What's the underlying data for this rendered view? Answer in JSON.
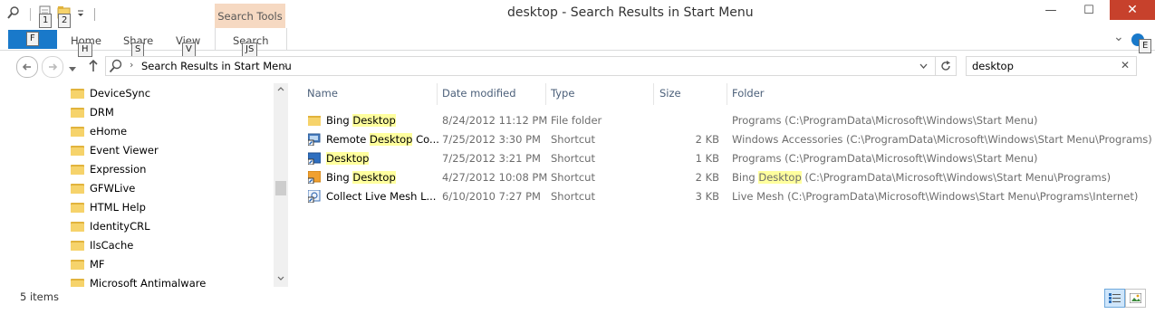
{
  "window": {
    "title": "desktop - Search Results in Start Menu",
    "contextual_tab": "Search Tools",
    "caption_minimize": "—",
    "caption_maximize": "☐",
    "caption_close": "✕"
  },
  "qat": {
    "keytips": [
      "1",
      "2"
    ]
  },
  "ribbon": {
    "file_label": "F",
    "tabs": [
      {
        "label": "Home",
        "keytip": "H"
      },
      {
        "label": "Share",
        "keytip": "S"
      },
      {
        "label": "View",
        "keytip": "V"
      },
      {
        "label": "Search",
        "keytip": "JS"
      }
    ],
    "expand_icon": "⌄",
    "help_keytip": "E"
  },
  "address": {
    "path_item": "Search Results in Start Menu",
    "search_value": "desktop",
    "search_clear": "✕"
  },
  "nav_pane": {
    "items": [
      "DeviceSync",
      "DRM",
      "eHome",
      "Event Viewer",
      "Expression",
      "GFWLive",
      "HTML Help",
      "IdentityCRL",
      "IlsCache",
      "MF",
      "Microsoft Antimalware"
    ]
  },
  "columns": {
    "name": "Name",
    "date": "Date modified",
    "type": "Type",
    "size": "Size",
    "folder": "Folder"
  },
  "files": [
    {
      "name_pre": "Bing ",
      "name_hl": "Desktop",
      "name_post": "",
      "date": "8/24/2012 11:12 PM",
      "type": "File folder",
      "size": "",
      "folder_pre": "Programs (C:\\ProgramData\\Microsoft\\Windows\\Start Menu)",
      "folder_hl": "",
      "folder_post": "",
      "icon": "folder-icon"
    },
    {
      "name_pre": "Remote ",
      "name_hl": "Desktop",
      "name_post": " Co...",
      "date": "7/25/2012 3:30 PM",
      "type": "Shortcut",
      "size": "2 KB",
      "folder_pre": "Windows Accessories (C:\\ProgramData\\Microsoft\\Windows\\Start Menu\\Programs)",
      "folder_hl": "",
      "folder_post": "",
      "icon": "remote-desktop-icon"
    },
    {
      "name_pre": "",
      "name_hl": "Desktop",
      "name_post": "",
      "date": "7/25/2012 3:21 PM",
      "type": "Shortcut",
      "size": "1 KB",
      "folder_pre": "Programs (C:\\ProgramData\\Microsoft\\Windows\\Start Menu)",
      "folder_hl": "",
      "folder_post": "",
      "icon": "desktop-shortcut-icon"
    },
    {
      "name_pre": "Bing ",
      "name_hl": "Desktop",
      "name_post": "",
      "date": "4/27/2012 10:08 PM",
      "type": "Shortcut",
      "size": "2 KB",
      "folder_pre": "Bing ",
      "folder_hl": "Desktop",
      "folder_post": " (C:\\ProgramData\\Microsoft\\Windows\\Start Menu\\Programs)",
      "icon": "bing-desktop-icon"
    },
    {
      "name_pre": "Collect Live Mesh L...",
      "name_hl": "",
      "name_post": "",
      "date": "6/10/2010 7:27 PM",
      "type": "Shortcut",
      "size": "3 KB",
      "folder_pre": "Live Mesh (C:\\ProgramData\\Microsoft\\Windows\\Start Menu\\Programs\\Internet)",
      "folder_hl": "",
      "folder_post": "",
      "icon": "live-mesh-icon"
    }
  ],
  "status": {
    "item_count": "5 items"
  },
  "colors": {
    "file_tab": "#1979ca",
    "context_tab": "#f6d9c2",
    "close_button": "#c7412c",
    "highlight": "#ffff9e",
    "header_text": "#4c607a"
  }
}
